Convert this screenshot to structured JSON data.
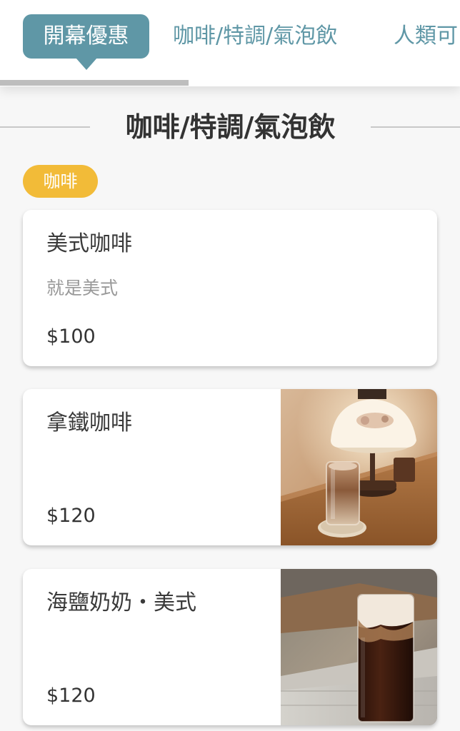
{
  "tabs": [
    {
      "label": "開幕優惠",
      "active": true
    },
    {
      "label": "咖啡/特調/氣泡飲",
      "active": false
    },
    {
      "label": "人類可",
      "active": false
    }
  ],
  "section": {
    "title": "咖啡/特調/氣泡飲",
    "category": "咖啡"
  },
  "menu_items": [
    {
      "name": "美式咖啡",
      "description": "就是美式",
      "price": "$100",
      "has_photo": false
    },
    {
      "name": "拿鐵咖啡",
      "description": "",
      "price": "$120",
      "has_photo": true,
      "photo": "latte-photo"
    },
    {
      "name": "海鹽奶奶・美式",
      "description": "",
      "price": "$120",
      "has_photo": true,
      "photo": "sea-salt-americano-photo"
    }
  ],
  "colors": {
    "accent_teal": "#5f97a6",
    "category_yellow": "#f2bb38",
    "background": "#f7f7f7"
  }
}
